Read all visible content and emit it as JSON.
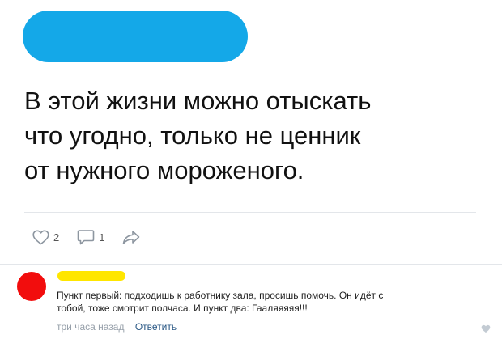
{
  "post": {
    "text": "В этой жизни можно отыскать\nчто угодно, только не ценник\nот нужного мороженого.",
    "author_blob_color": "#14a8e8",
    "actions": {
      "likes": "2",
      "comments": "1"
    }
  },
  "comment": {
    "avatar_color": "#f20d0d",
    "author_blob_color": "#ffe600",
    "text": "Пункт первый: подходишь к работнику зала, просишь помочь. Он идёт с\nтобой, тоже смотрит полчаса. И пункт два: Гааляяяяя!!!",
    "time": "три часа назад",
    "reply_label": "Ответить"
  },
  "icons": [
    "heart-icon",
    "comment-icon",
    "share-icon",
    "comment-heart-icon"
  ]
}
